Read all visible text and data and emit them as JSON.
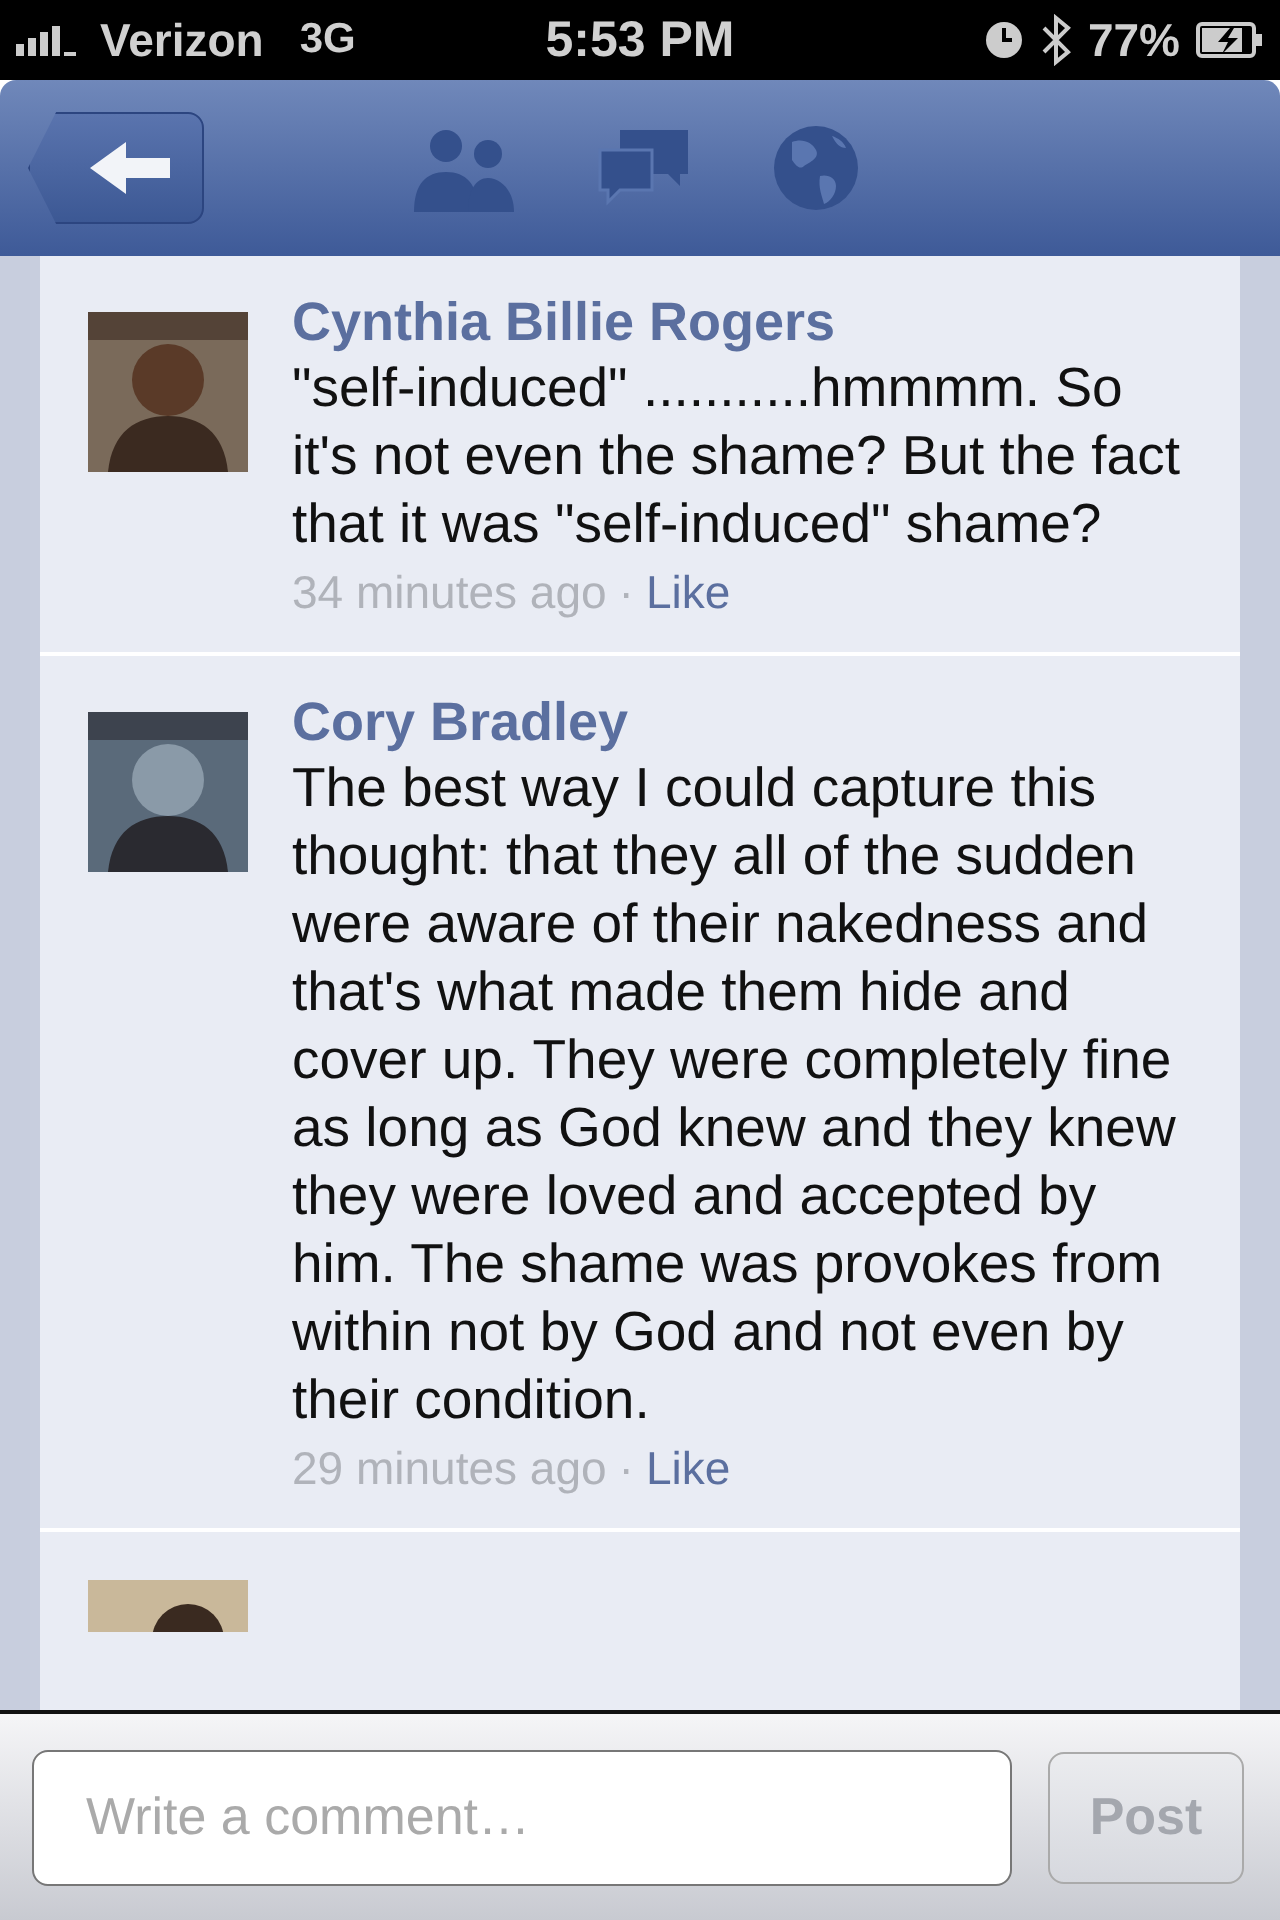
{
  "status_bar": {
    "carrier": "Verizon",
    "network": "3G",
    "time": "5:53 PM",
    "battery": "77%"
  },
  "comments": [
    {
      "kind": "full",
      "author": "Cynthia Billie Rogers",
      "text": "\"self-induced\" ...........hmmmm. So it's not even the shame? But the fact that it was \"self-induced\" shame?",
      "time": "34 minutes ago",
      "separator": "·",
      "like": "Like"
    },
    {
      "kind": "full",
      "author": "Cory Bradley",
      "text": "The best way I could capture this thought: that they all of the sudden were aware of their nakedness and that's what made them hide and cover up. They were completely fine as long as God knew and they knew they were loved and accepted by him. The shame was provokes from within not by God and not even by their condition.",
      "time": "29 minutes ago",
      "separator": "·",
      "like": "Like"
    },
    {
      "kind": "partial"
    }
  ],
  "composer": {
    "placeholder": "Write a comment…",
    "button": "Post"
  }
}
